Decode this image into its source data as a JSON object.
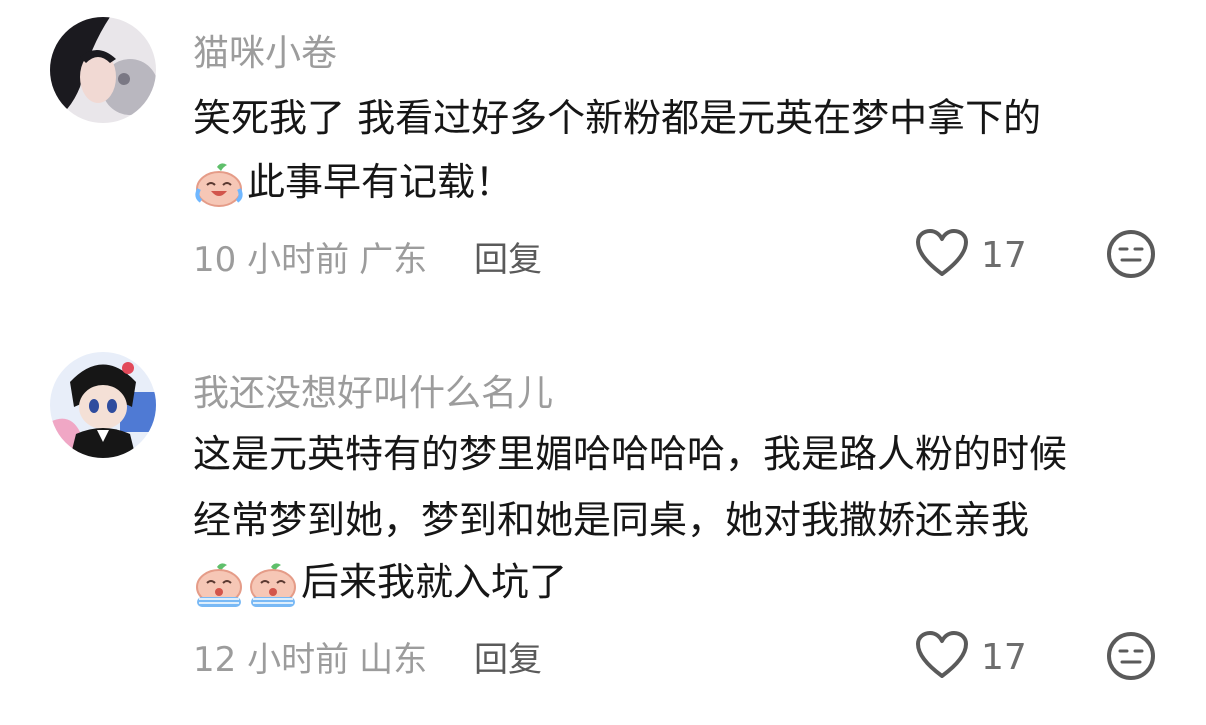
{
  "comments": [
    {
      "username": "猫咪小卷",
      "lines": [
        "笑死我了 我看过好多个新粉都是元英在梦中拿下的",
        "此事早有记载！"
      ],
      "emoji_count_line2": 1,
      "time": "10 小时前",
      "location": "广东",
      "reply": "回复",
      "likes": "17"
    },
    {
      "username": "我还没想好叫什么名儿",
      "lines": [
        "这是元英特有的梦里媚哈哈哈哈，我是路人粉的时候",
        "经常梦到她，梦到和她是同桌，她对我撒娇还亲我",
        "后来我就入坑了"
      ],
      "emoji_count_line3": 2,
      "time": "12 小时前",
      "location": "山东",
      "reply": "回复",
      "likes": "17"
    }
  ],
  "icons": {
    "like": "heart-outline-icon",
    "dislike": "meh-face-icon",
    "emoji1": "laughing-tears-peach-emoji",
    "emoji2": "crying-peach-emoji"
  },
  "colors": {
    "text": "#161616",
    "muted": "#9c9c9c",
    "reply": "#5a5a5a"
  }
}
